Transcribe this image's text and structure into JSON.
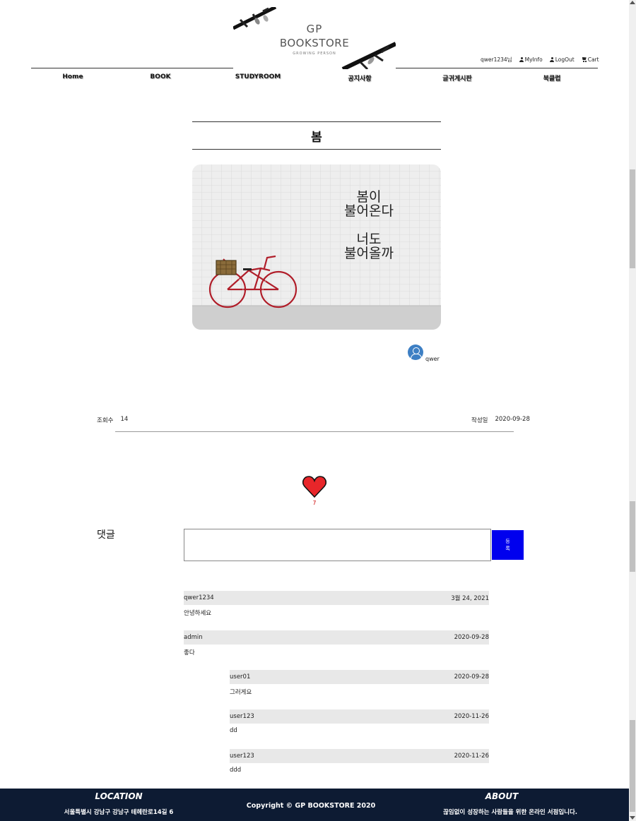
{
  "header": {
    "logo": {
      "line1": "GP",
      "line2": "BOOKSTORE",
      "tagline": "GROWING PERSON"
    },
    "user_greeting": "qwer1234님",
    "links": {
      "myinfo": "MyInfo",
      "logout": "LogOut",
      "cart": "Cart"
    },
    "nav": [
      "Home",
      "BOOK",
      "STUDYROOM",
      "공지사항",
      "글귀게시판",
      "북클럽"
    ]
  },
  "post": {
    "title": "봄",
    "image_text": [
      "봄이",
      "불어온다",
      "",
      "너도",
      "불어올까"
    ],
    "author": "qwer",
    "views_label": "조회수",
    "views": "14",
    "date_label": "작성일",
    "date": "2020-09-28",
    "like_count": "7",
    "colors": {
      "heart": "#e8262a",
      "submit": "#0000ee",
      "footer": "#0d1b33",
      "avatar": "#3d7fc4"
    }
  },
  "comments_section": {
    "label": "댓글",
    "input_value": "",
    "submit_label": "등록",
    "comments": [
      {
        "user": "qwer1234",
        "date": "3월 24, 2021",
        "text": "안녕하세요",
        "reply": false
      },
      {
        "user": "admin",
        "date": "2020-09-28",
        "text": "좋다",
        "reply": false
      },
      {
        "user": "user01",
        "date": "2020-09-28",
        "text": "그러게요",
        "reply": true
      },
      {
        "user": "user123",
        "date": "2020-11-26",
        "text": "dd",
        "reply": true
      },
      {
        "user": "user123",
        "date": "2020-11-26",
        "text": "ddd",
        "reply": true
      }
    ]
  },
  "footer": {
    "location_title": "LOCATION",
    "address": "서울특별시 강남구 강남구 테헤란로14길 6",
    "copyright": "Copyright © GP BOOKSTORE 2020",
    "about_title": "ABOUT",
    "about_text": "끊임없이 성장하는 사람들을 위한 온라인 서점입니다."
  }
}
